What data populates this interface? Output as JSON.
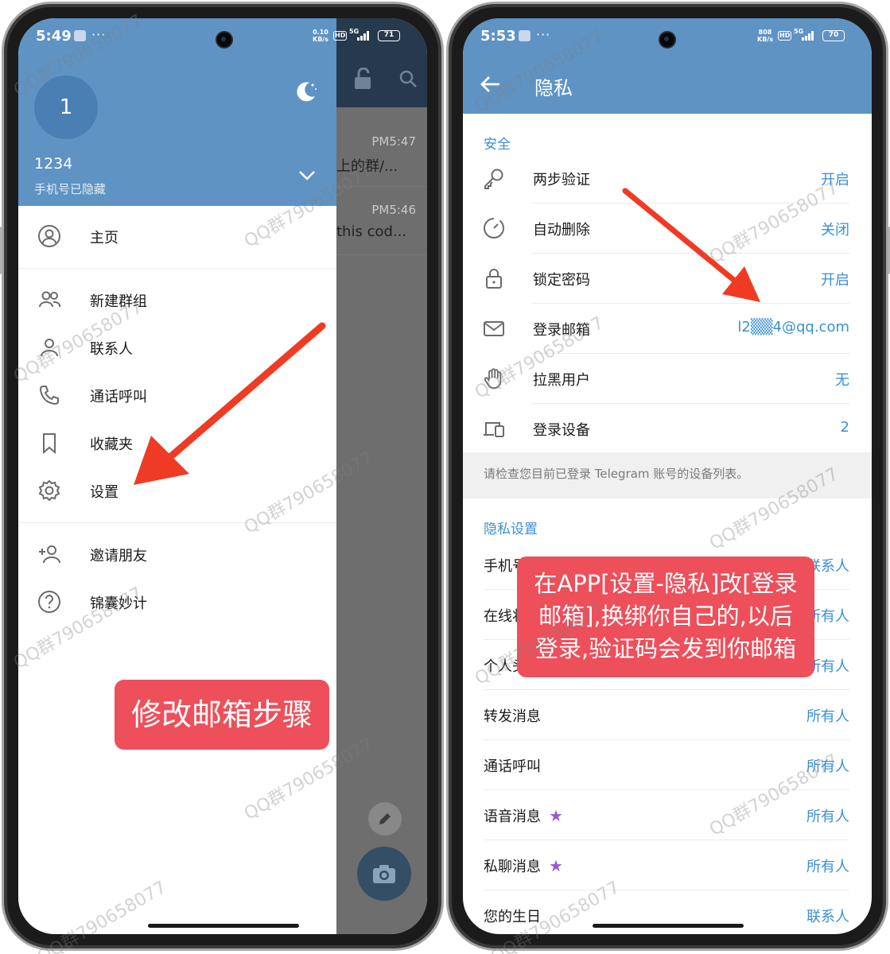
{
  "watermark": "QQ群790658077",
  "colors": {
    "header_blue": "#5e93c4",
    "accent_blue": "#3a8fd6",
    "callout_red": "#ed4f5b",
    "arrow_red": "#ef3b24"
  },
  "left_phone": {
    "status": {
      "time": "5:49",
      "dots": "···",
      "speed_top": "0.10",
      "speed_bottom": "KB/s",
      "hd": "HD",
      "net": "5G",
      "battery": "71"
    },
    "chats": [
      {
        "time": "PM5:47",
        "snippet": "上的群/..."
      },
      {
        "time": "PM5:46",
        "snippet": "this cod..."
      }
    ],
    "drawer": {
      "avatar_initial": "1",
      "user_name": "1234",
      "phone_status": "手机号已隐藏",
      "items": [
        {
          "label": "主页",
          "icon": "profile-icon"
        },
        {
          "label": "新建群组",
          "icon": "group-icon"
        },
        {
          "label": "联系人",
          "icon": "contact-icon"
        },
        {
          "label": "通话呼叫",
          "icon": "phone-icon"
        },
        {
          "label": "收藏夹",
          "icon": "bookmark-icon"
        },
        {
          "label": "设置",
          "icon": "gear-icon"
        },
        {
          "label": "邀请朋友",
          "icon": "add-person-icon"
        },
        {
          "label": "锦囊妙计",
          "icon": "help-icon"
        }
      ]
    },
    "callout": "修改邮箱步骤"
  },
  "right_phone": {
    "status": {
      "time": "5:53",
      "dots": "···",
      "speed_top": "808",
      "speed_bottom": "KB/s",
      "hd": "HD",
      "net": "5G",
      "battery": "70"
    },
    "title": "隐私",
    "security_section": "安全",
    "security_rows": [
      {
        "label": "两步验证",
        "value": "开启",
        "icon": "key-icon"
      },
      {
        "label": "自动删除",
        "value": "关闭",
        "icon": "timer-icon"
      },
      {
        "label": "锁定密码",
        "value": "开启",
        "icon": "lock-icon"
      },
      {
        "label": "登录邮箱",
        "value": "l2▒▒4@qq.com",
        "icon": "mail-icon"
      },
      {
        "label": "拉黑用户",
        "value": "无",
        "icon": "hand-icon"
      },
      {
        "label": "登录设备",
        "value": "2",
        "icon": "devices-icon"
      }
    ],
    "devices_info": "请检查您目前已登录 Telegram 账号的设备列表。",
    "privacy_section": "隐私设置",
    "privacy_rows": [
      {
        "label": "手机号码",
        "value": "联系人"
      },
      {
        "label": "在线状态",
        "value": "所有人"
      },
      {
        "label": "个人头像",
        "value": "所有人"
      },
      {
        "label": "转发消息",
        "value": "所有人"
      },
      {
        "label": "通话呼叫",
        "value": "所有人"
      },
      {
        "label": "语音消息",
        "value": "所有人",
        "star": "★"
      },
      {
        "label": "私聊消息",
        "value": "所有人",
        "star": "★"
      },
      {
        "label": "您的生日",
        "value": "联系人"
      }
    ],
    "callout_lines": [
      "在APP[设置-隐私]改[登录",
      "邮箱],换绑你自己的,以后",
      "登录,验证码会发到你邮箱"
    ]
  }
}
